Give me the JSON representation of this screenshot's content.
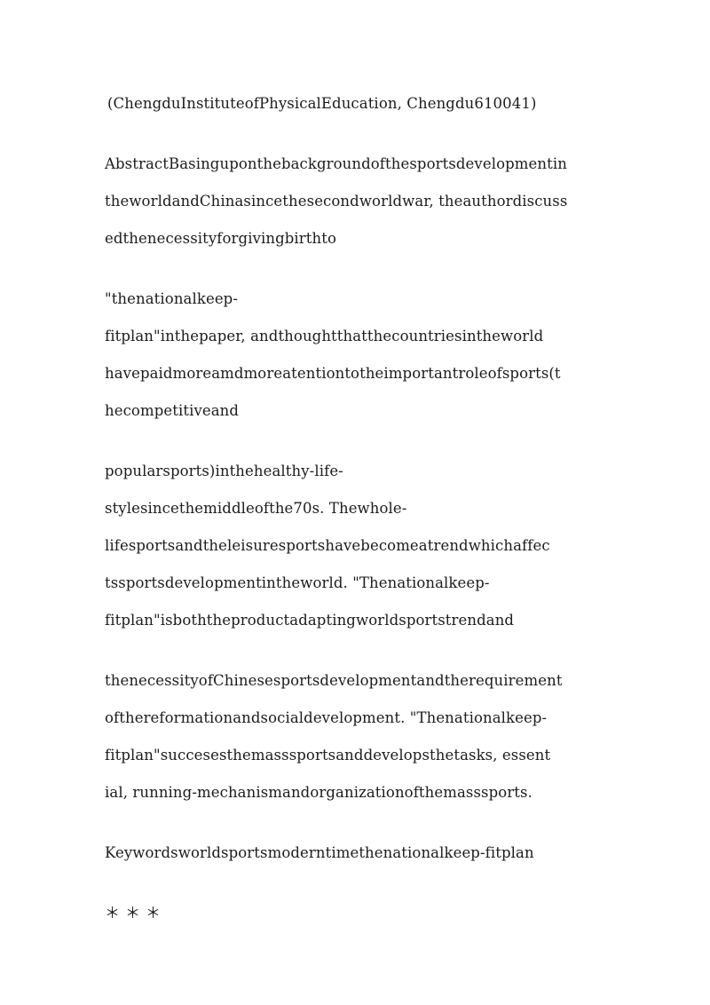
{
  "document": {
    "background_color": "#ffffff",
    "text_color": "#1c1c1c",
    "affiliation": {
      "lines": [
        "(ChengduInstituteofPhysicalEducation, Chengdu610041)"
      ]
    },
    "abstract": {
      "lines": [
        "AbstractBasinguponthebackgroundofthesportsdevelopmentin",
        "theworldandChinasincethesecondworldwar, theauthordiscuss",
        "edthenecessityforgivingbirthto"
      ]
    },
    "quote_paragraph": {
      "lines": [
        "\"thenationalkeep-",
        "fitplan\"inthepaper, andthoughtthatthecountriesintheworld",
        "havepaidmoreamdmoreatentiontotheimportantroleofsports(t",
        "hecompetitiveand"
      ]
    },
    "popular_paragraph": {
      "lines": [
        "popularsports)inthehealthy-life-",
        "stylesincethemiddleofthe70s. Thewhole-",
        "lifesportsandtheleisuresportshavebecomeatrendwhichaffec",
        "tssportsdevelopmentintheworld. \"Thenationalkeep-",
        "fitplan\"isboththeproductadaptingworldsportstrendand"
      ]
    },
    "necessity_paragraph": {
      "lines": [
        "thenecessityofChinesesportsdevelopmentandtherequirement",
        "ofthereformationandsocialdevelopment. \"Thenationalkeep-",
        "fitplan\"succesesthemasssportsanddevelopsthetasks, essent",
        "ial, running-mechanismandorganizationofthemasssports."
      ]
    },
    "keywords": {
      "lines": [
        "Keywordsworldsportsmoderntimethenationalkeep-fitplan"
      ]
    },
    "section_marks": {
      "lines": [
        "＊＊＊"
      ]
    }
  }
}
